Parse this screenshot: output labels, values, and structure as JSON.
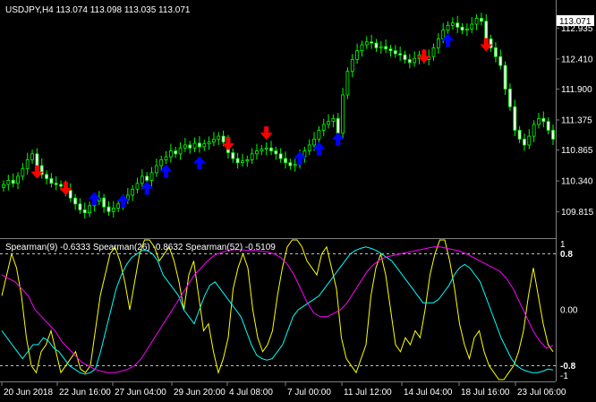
{
  "window": {
    "symbol_line": "USDJPY,H4  113.074 113.098 113.035 113.071"
  },
  "main_chart": {
    "current_price_label": "113.071",
    "price_ticks": [
      "112.935",
      "112.410",
      "111.900",
      "111.375",
      "110.865",
      "110.340",
      "109.815"
    ],
    "price_tick_values": [
      112.935,
      112.41,
      111.9,
      111.375,
      110.865,
      110.34,
      109.815
    ],
    "colors": {
      "bull": "#00ff00",
      "sell_arrow": "#ff0000",
      "buy_arrow": "#0000ff"
    },
    "sell_signals": [
      {
        "bar": 7,
        "price": 110.62
      },
      {
        "bar": 13,
        "price": 110.34
      },
      {
        "bar": 47,
        "price": 111.1
      },
      {
        "bar": 55,
        "price": 111.28
      },
      {
        "bar": 88,
        "price": 112.58
      },
      {
        "bar": 101,
        "price": 112.78
      }
    ],
    "buy_signals": [
      {
        "bar": 19,
        "price": 109.91
      },
      {
        "bar": 25,
        "price": 109.87
      },
      {
        "bar": 30,
        "price": 110.09
      },
      {
        "bar": 34,
        "price": 110.38
      },
      {
        "bar": 41,
        "price": 110.52
      },
      {
        "bar": 62,
        "price": 110.6
      },
      {
        "bar": 66,
        "price": 110.76
      },
      {
        "bar": 70,
        "price": 110.92
      },
      {
        "bar": 93,
        "price": 112.6
      }
    ]
  },
  "indicator": {
    "title": "Spearman(9) -0.6333  Spearman(26) -0.8632  Spearman(52) -0.5109",
    "tick_labels": [
      "1",
      "0.8",
      "0.00",
      "-0.8",
      "-1"
    ],
    "tick_values": [
      1,
      0.8,
      0,
      -0.8,
      -1
    ],
    "colors": {
      "fast": "#ffff00",
      "mid": "#00ffff",
      "slow": "#ff00ff"
    }
  },
  "time_axis": {
    "labels": [
      "20 Jun 2018",
      "22 Jun 16:00",
      "27 Jun 04:00",
      "29 Jun 20:00",
      "4 Jul 08:00",
      "7 Jul 00:00",
      "11 Jul 12:00",
      "14 Jul 04:00",
      "18 Jul 16:00",
      "23 Jul 06:00"
    ]
  },
  "chart_data": [
    {
      "type": "candlestick",
      "title": "USDJPY,H4",
      "ylim": [
        109.43,
        113.35
      ],
      "close": [
        110.28,
        110.35,
        110.3,
        110.42,
        110.55,
        110.7,
        110.8,
        110.6,
        110.45,
        110.38,
        110.3,
        110.28,
        110.25,
        110.18,
        110.05,
        109.95,
        109.85,
        109.8,
        109.92,
        110.0,
        110.05,
        109.9,
        109.82,
        109.88,
        109.95,
        110.02,
        110.1,
        110.2,
        110.3,
        110.42,
        110.35,
        110.48,
        110.6,
        110.7,
        110.75,
        110.85,
        110.8,
        110.9,
        110.95,
        110.9,
        110.98,
        110.92,
        110.97,
        111.0,
        111.05,
        111.1,
        111.0,
        110.82,
        110.72,
        110.65,
        110.68,
        110.7,
        110.8,
        110.85,
        110.88,
        110.9,
        110.85,
        110.8,
        110.72,
        110.65,
        110.6,
        110.62,
        110.75,
        110.85,
        110.95,
        111.05,
        111.2,
        111.3,
        111.35,
        111.4,
        111.15,
        111.8,
        112.2,
        112.4,
        112.55,
        112.65,
        112.7,
        112.68,
        112.6,
        112.62,
        112.58,
        112.55,
        112.5,
        112.48,
        112.4,
        112.35,
        112.42,
        112.48,
        112.4,
        112.45,
        112.6,
        112.75,
        112.9,
        112.98,
        113.02,
        112.95,
        112.9,
        112.92,
        113.0,
        113.1,
        113.05,
        112.75,
        112.6,
        112.45,
        112.3,
        111.9,
        111.6,
        111.2,
        111.05,
        110.95,
        111.1,
        111.3,
        111.4,
        111.35,
        111.2,
        111.05
      ]
    },
    {
      "type": "line",
      "title": "Spearman(9) -0.6333  Spearman(26) -0.8632  Spearman(52) -0.5109",
      "ylim": [
        -1,
        1
      ],
      "series": [
        {
          "name": "Spearman(9)",
          "values": [
            0.2,
            0.5,
            0.8,
            0.6,
            0.2,
            -0.4,
            -0.8,
            -0.9,
            -0.6,
            -0.5,
            -0.3,
            -0.6,
            -0.9,
            -0.8,
            -0.7,
            -0.6,
            -0.85,
            -0.9,
            -0.8,
            -0.3,
            0.2,
            0.5,
            0.8,
            0.9,
            0.7,
            0.4,
            0.0,
            0.4,
            0.8,
            1.0,
            1.0,
            0.9,
            0.7,
            0.8,
            0.9,
            0.7,
            0.4,
            0.0,
            0.5,
            0.7,
            0.2,
            -0.3,
            -0.2,
            -0.6,
            -0.9,
            -0.7,
            -0.4,
            0.3,
            0.6,
            0.8,
            0.6,
            0.0,
            -0.4,
            -0.6,
            -0.5,
            -0.3,
            0.2,
            0.6,
            0.9,
            1.0,
            1.0,
            0.9,
            0.7,
            0.6,
            0.5,
            0.8,
            0.9,
            0.6,
            0.3,
            -0.4,
            -0.7,
            -0.8,
            -0.9,
            -0.7,
            -0.5,
            0.2,
            0.6,
            0.8,
            0.5,
            0.0,
            -0.5,
            -0.6,
            -0.4,
            -0.5,
            -0.3,
            -0.4,
            0.0,
            0.5,
            0.8,
            1.0,
            1.0,
            0.7,
            0.3,
            -0.2,
            -0.5,
            -0.7,
            -0.4,
            -0.3,
            -0.6,
            -0.8,
            -0.9,
            -1.0,
            -1.0,
            -0.9,
            -0.8,
            -0.6,
            -0.3,
            0.2,
            0.6,
            0.2,
            -0.2,
            -0.5,
            -0.6
          ]
        },
        {
          "name": "Spearman(26)",
          "values": [
            -0.3,
            -0.4,
            -0.5,
            -0.6,
            -0.7,
            -0.6,
            -0.5,
            -0.5,
            -0.4,
            -0.45,
            -0.55,
            -0.6,
            -0.7,
            -0.8,
            -0.85,
            -0.9,
            -0.92,
            -0.9,
            -0.85,
            -0.6,
            -0.3,
            0.0,
            0.3,
            0.5,
            0.65,
            0.75,
            0.8,
            0.85,
            0.85,
            0.8,
            0.7,
            0.5,
            0.4,
            0.3,
            0.2,
            0.0,
            -0.1,
            -0.2,
            0.0,
            0.2,
            0.35,
            0.4,
            0.3,
            0.2,
            0.1,
            0.0,
            -0.1,
            -0.3,
            -0.5,
            -0.65,
            -0.7,
            -0.72,
            -0.7,
            -0.6,
            -0.5,
            -0.3,
            -0.1,
            0.0,
            0.05,
            0.1,
            0.15,
            0.2,
            0.3,
            0.4,
            0.5,
            0.6,
            0.7,
            0.8,
            0.85,
            0.88,
            0.9,
            0.88,
            0.85,
            0.8,
            0.75,
            0.7,
            0.6,
            0.5,
            0.4,
            0.3,
            0.2,
            0.1,
            0.1,
            0.1,
            0.15,
            0.25,
            0.35,
            0.5,
            0.6,
            0.65,
            0.6,
            0.5,
            0.4,
            0.2,
            0.0,
            -0.2,
            -0.4,
            -0.55,
            -0.7,
            -0.8,
            -0.85,
            -0.88,
            -0.9,
            -0.9,
            -0.88,
            -0.85,
            -0.86
          ]
        },
        {
          "name": "Spearman(52)",
          "values": [
            0.5,
            0.45,
            0.4,
            0.3,
            0.2,
            0.0,
            -0.1,
            -0.2,
            -0.3,
            -0.45,
            -0.55,
            -0.65,
            -0.75,
            -0.8,
            -0.85,
            -0.88,
            -0.9,
            -0.9,
            -0.88,
            -0.85,
            -0.8,
            -0.7,
            -0.55,
            -0.4,
            -0.25,
            -0.1,
            0.05,
            0.2,
            0.35,
            0.5,
            0.6,
            0.7,
            0.78,
            0.82,
            0.85,
            0.86,
            0.86,
            0.85,
            0.85,
            0.84,
            0.83,
            0.8,
            0.75,
            0.65,
            0.5,
            0.3,
            0.1,
            -0.05,
            -0.1,
            -0.1,
            -0.05,
            0.0,
            0.1,
            0.25,
            0.4,
            0.55,
            0.65,
            0.72,
            0.76,
            0.78,
            0.8,
            0.82,
            0.84,
            0.86,
            0.88,
            0.9,
            0.9,
            0.88,
            0.86,
            0.84,
            0.8,
            0.75,
            0.7,
            0.65,
            0.6,
            0.55,
            0.45,
            0.3,
            0.1,
            -0.1,
            -0.3,
            -0.45,
            -0.55,
            -0.51
          ]
        }
      ]
    }
  ]
}
